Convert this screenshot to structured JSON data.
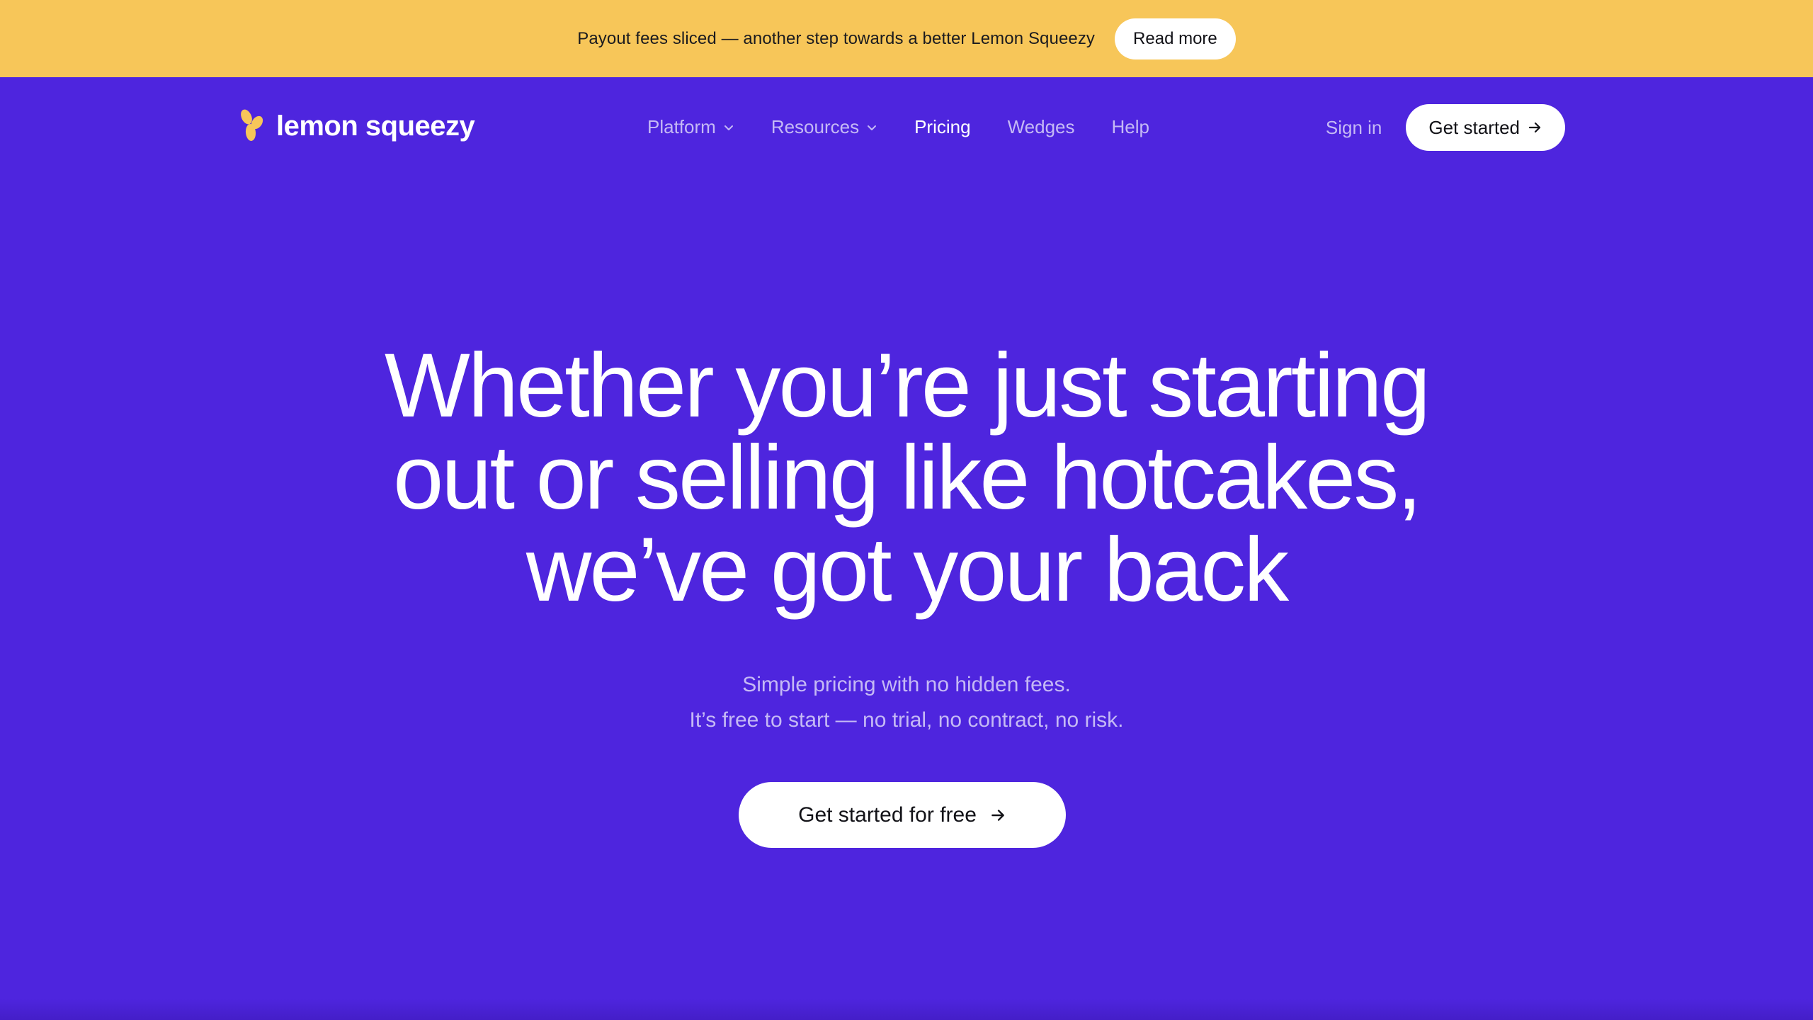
{
  "announcement": {
    "text": "Payout fees sliced — another step towards a better Lemon Squeezy",
    "button_label": "Read more"
  },
  "nav": {
    "logo_text": "lemon squeezy",
    "links": [
      {
        "label": "Platform",
        "has_dropdown": true
      },
      {
        "label": "Resources",
        "has_dropdown": true
      },
      {
        "label": "Pricing",
        "active": true
      },
      {
        "label": "Wedges"
      },
      {
        "label": "Help"
      }
    ],
    "sign_in": "Sign in",
    "get_started": "Get started"
  },
  "hero": {
    "headline_lines": [
      "Whether you’re just starting",
      "out or selling like hotcakes,",
      "we’ve got your back"
    ],
    "sub_lines": [
      "Simple pricing with no hidden fees.",
      "It’s free to start — no trial, no contract, no risk."
    ],
    "cta_label": "Get started for free"
  },
  "colors": {
    "brand_purple": "#4e25de",
    "banner_yellow": "#f7c659",
    "muted_text": "#c5b9f5",
    "white": "#ffffff"
  },
  "icons": {
    "logo": "lemon-logo-icon",
    "dropdown": "chevron-down-icon",
    "arrow": "arrow-right-icon"
  }
}
